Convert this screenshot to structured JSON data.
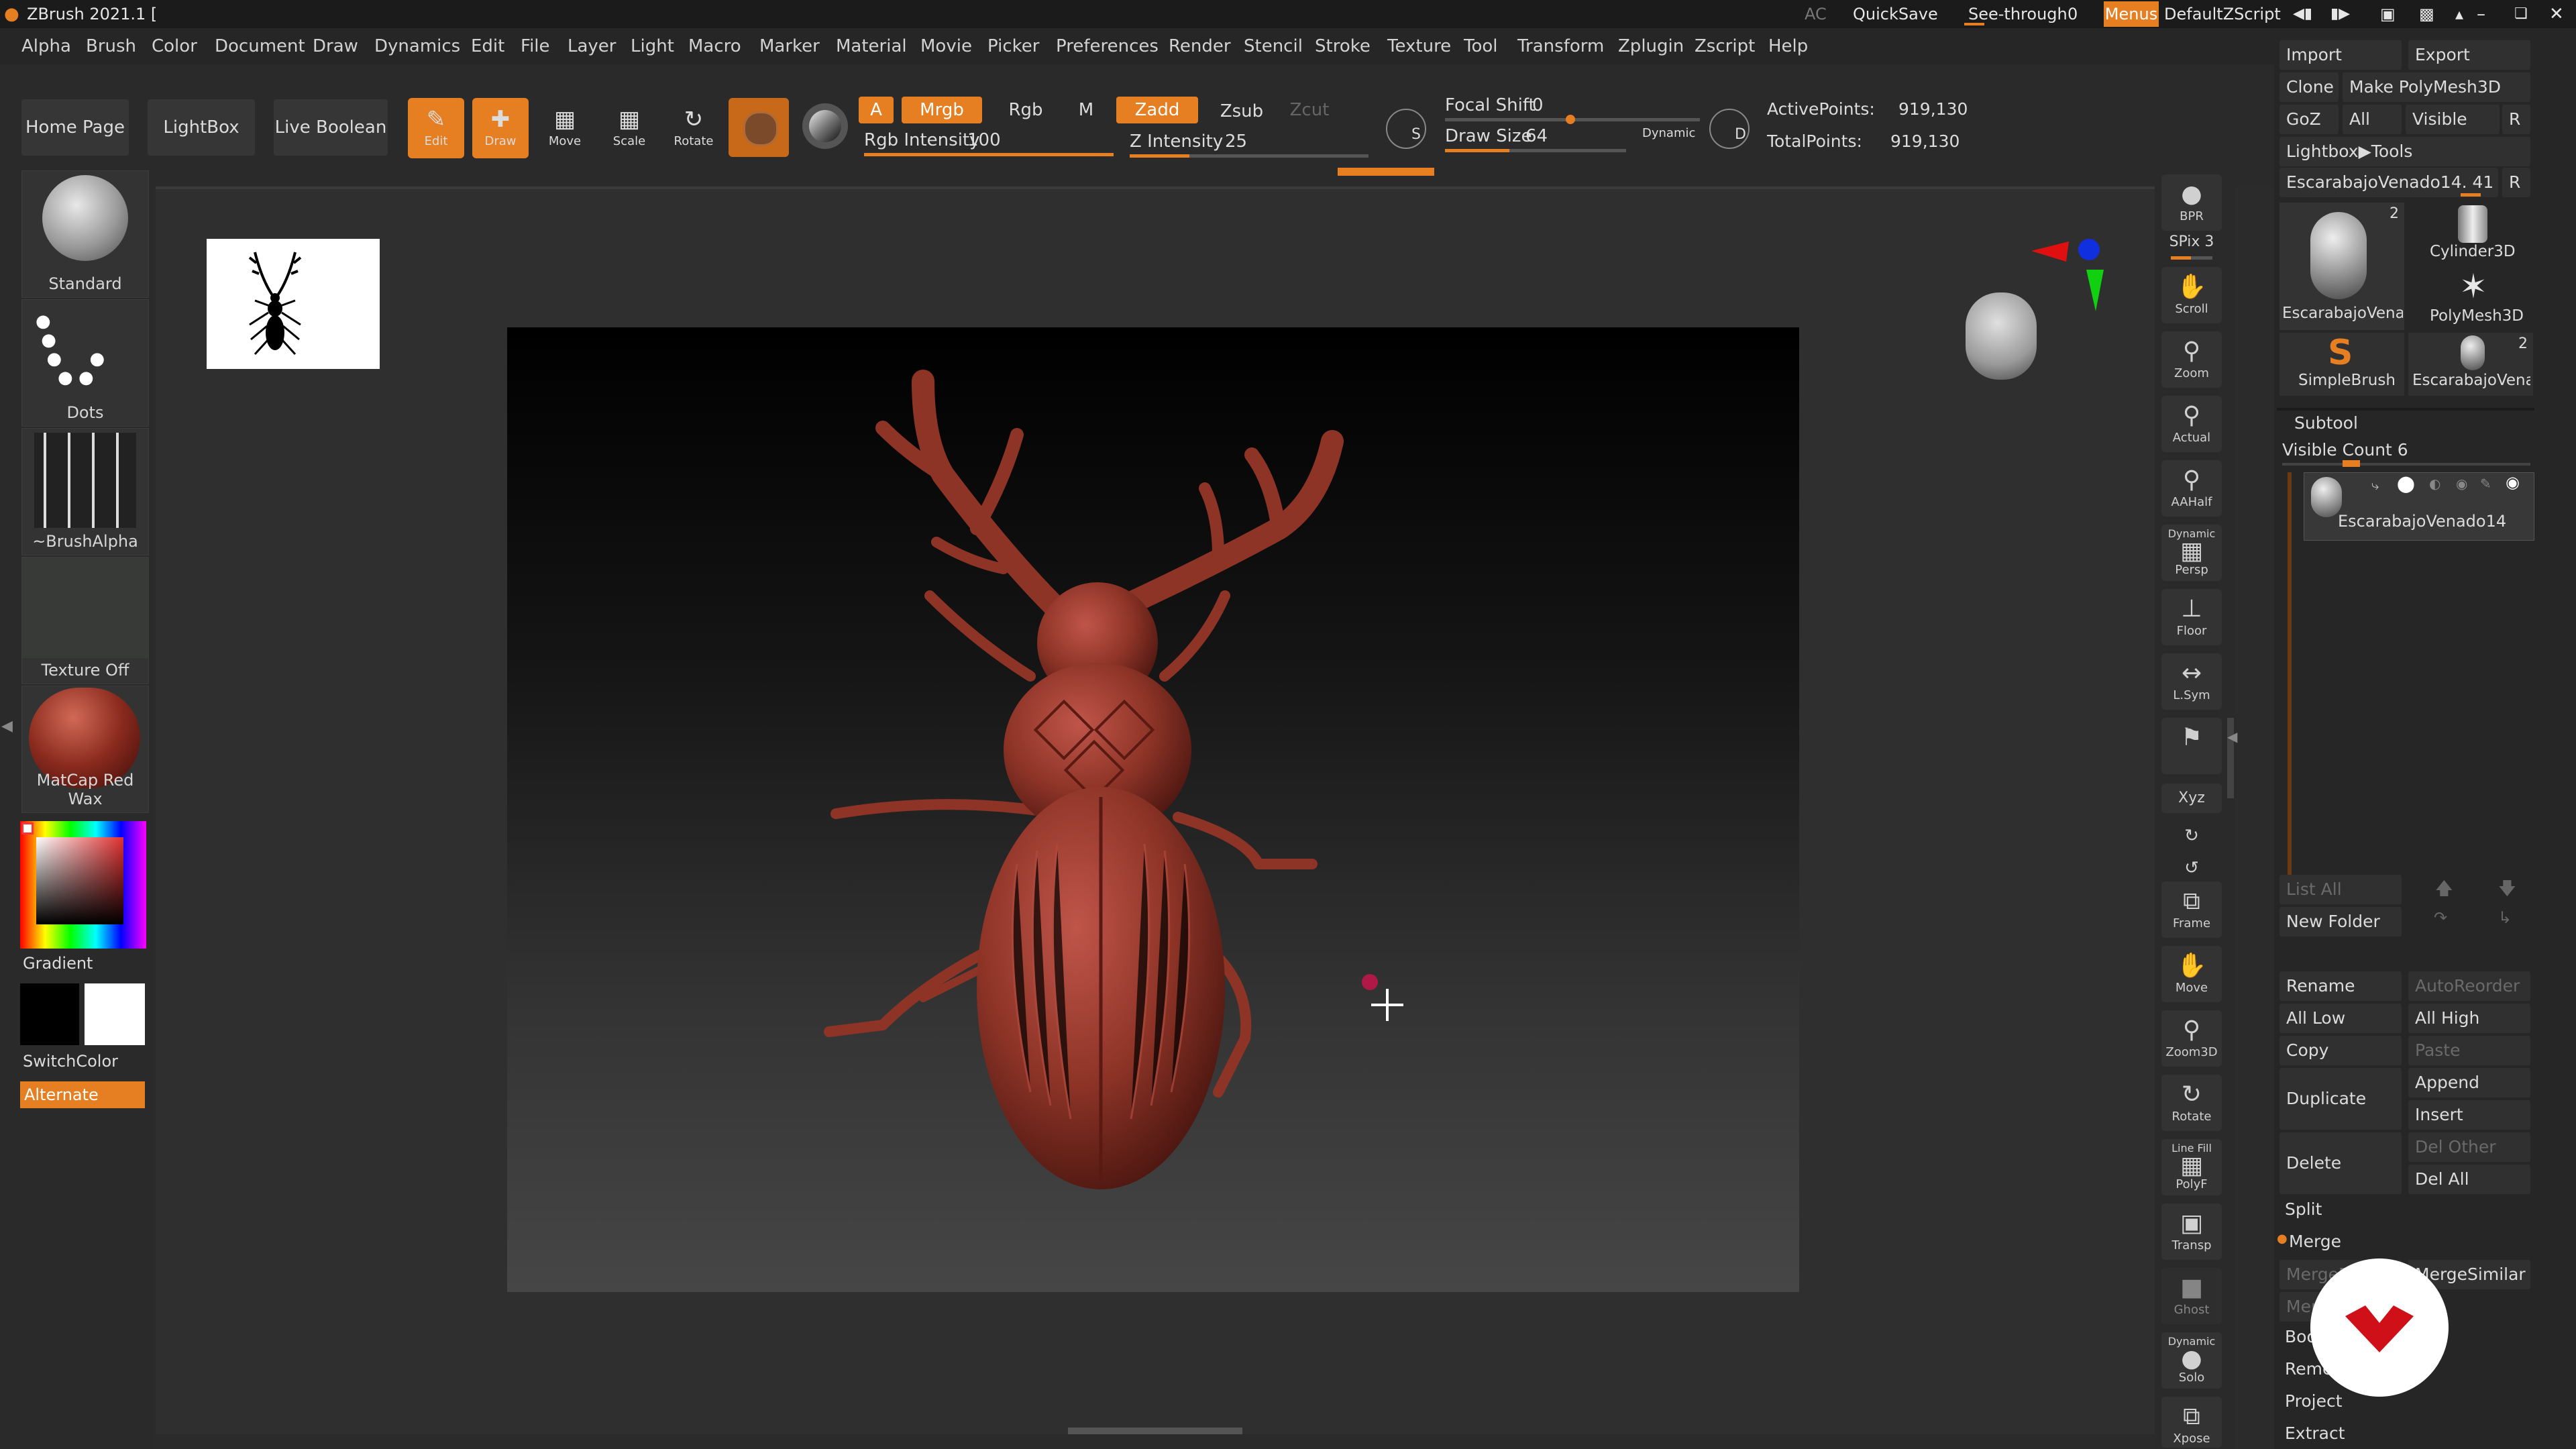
{
  "titlebar": {
    "app_title": "ZBrush 2021.1 [",
    "ac": "AC",
    "quicksave": "QuickSave",
    "see_through_label": "See-through",
    "see_through_value": "0",
    "menus": "Menus",
    "script": "DefaultZScript"
  },
  "menubar": [
    "Alpha",
    "Brush",
    "Color",
    "Document",
    "Draw",
    "Dynamics",
    "Edit",
    "File",
    "Layer",
    "Light",
    "Macro",
    "Marker",
    "Material",
    "Movie",
    "Picker",
    "Preferences",
    "Render",
    "Stencil",
    "Stroke",
    "Texture",
    "Tool",
    "Transform",
    "Zplugin",
    "Zscript",
    "Help"
  ],
  "toolbar": {
    "home_page": "Home Page",
    "lightbox": "LightBox",
    "live_boolean": "Live Boolean",
    "tools": [
      {
        "label": "Edit",
        "active": true
      },
      {
        "label": "Draw",
        "active": true
      },
      {
        "label": "Move",
        "active": false
      },
      {
        "label": "Scale",
        "active": false
      },
      {
        "label": "Rotate",
        "active": false
      }
    ],
    "a": "A",
    "mrgb": "Mrgb",
    "rgb": "Rgb",
    "m": "M",
    "zadd": "Zadd",
    "zsub": "Zsub",
    "zcut": "Zcut",
    "rgb_intensity_label": "Rgb Intensity",
    "rgb_intensity": "100",
    "rgb_intensity_frac": 1.0,
    "z_intensity_label": "Z Intensity",
    "z_intensity": "25",
    "z_intensity_frac": 0.25,
    "focal_shift_label": "Focal Shift",
    "focal_shift": "0",
    "draw_size_label": "Draw Size",
    "draw_size": "64",
    "dynamic": "Dynamic",
    "s_label": "S",
    "d_label": "D",
    "active_points_label": "ActivePoints:",
    "active_points": "919,130",
    "total_points_label": "TotalPoints:",
    "total_points": "919,130"
  },
  "leftpanel": {
    "brush": "Standard",
    "stroke": "Dots",
    "alpha": "~BrushAlpha",
    "texture": "Texture Off",
    "material": "MatCap Red Wax",
    "gradient": "Gradient",
    "switchcolor": "SwitchColor",
    "alternate": "Alternate",
    "colors": {
      "primary": "#000000",
      "secondary": "#ffffff",
      "material": "#8a2a1e"
    }
  },
  "rightcol": [
    "BPR",
    "SPix 3",
    "Scroll",
    "Zoom",
    "Actual",
    "AAHalf",
    "Persp",
    "Floor",
    "L.Sym",
    "",
    "Xyz",
    "",
    "",
    "Frame",
    "Move",
    "Zoom3D",
    "Rotate",
    "PolyF",
    "Transp",
    "Ghost",
    "Solo",
    "Xpose"
  ],
  "rightcol_extra": {
    "dynamic": "Dynamic",
    "line_fill": "Line Fill"
  },
  "rightpanel": {
    "import": "Import",
    "export": "Export",
    "clone": "Clone",
    "make_polymesh": "Make PolyMesh3D",
    "goz": "GoZ",
    "all": "All",
    "visible": "Visible",
    "r": "R",
    "lightbox_tools": "Lightbox▶Tools",
    "current_tool": "EscarabajoVenado14. 41",
    "tools": [
      {
        "name": "EscarabajoVenad",
        "count": "2"
      },
      {
        "name": "Cylinder3D",
        "count": ""
      },
      {
        "name": "PolyMesh3D",
        "count": ""
      },
      {
        "name": "SimpleBrush",
        "count": ""
      },
      {
        "name": "EscarabajoVenad",
        "count": "2"
      }
    ],
    "subtool": "Subtool",
    "visible_count": "Visible Count 6",
    "subtool_name": "EscarabajoVenado14",
    "list_all": "List All",
    "new_folder": "New Folder",
    "rename": "Rename",
    "autoreorder": "AutoReorder",
    "all_low": "All Low",
    "all_high": "All High",
    "copy": "Copy",
    "paste": "Paste",
    "duplicate": "Duplicate",
    "append": "Append",
    "insert": "Insert",
    "delete": "Delete",
    "del_other": "Del Other",
    "del_all": "Del All",
    "split": "Split",
    "merge": "Merge",
    "mergedown": "MergeDown",
    "mergesimilar": "MergeSimilar",
    "mergevisible": "MergeVisible",
    "boolean": "Boolean",
    "remesh": "Remesh",
    "project": "Project",
    "extract": "Extract"
  }
}
